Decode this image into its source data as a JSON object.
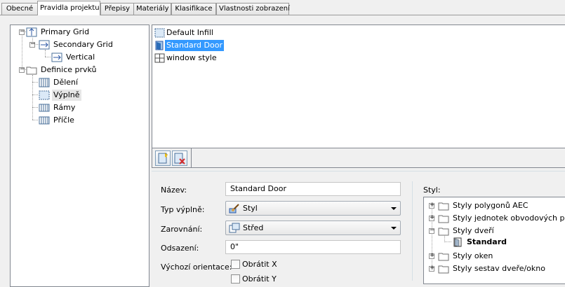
{
  "tabs": [
    {
      "label": "Obecné"
    },
    {
      "label": "Pravidla projektu"
    },
    {
      "label": "Přepisy"
    },
    {
      "label": "Materiály"
    },
    {
      "label": "Klasifikace"
    },
    {
      "label": "Vlastnosti zobrazení"
    }
  ],
  "active_tab": "Pravidla projektu",
  "left_tree": {
    "primary_grid": "Primary Grid",
    "secondary_grid": "Secondary Grid",
    "vertical": "Vertical",
    "definice": "Definice prvků",
    "deleni": "Dělení",
    "vyplne": "Výplně",
    "ramy": "Rámy",
    "pricle": "Příčle"
  },
  "infill_list": {
    "items": [
      {
        "label": "Default Infill",
        "icon": "infill-icon"
      },
      {
        "label": "Standard Door",
        "icon": "door-icon",
        "selected": true
      },
      {
        "label": "window style",
        "icon": "window-icon"
      }
    ]
  },
  "toolbar": {
    "add_icon": "new-infill-icon",
    "remove_icon": "delete-infill-icon"
  },
  "form": {
    "name_label": "Název:",
    "name_value": "Standard Door",
    "type_label": "Typ výplně:",
    "type_value": "Styl",
    "align_label": "Zarovnání:",
    "align_value": "Střed",
    "offset_label": "Odsazení:",
    "offset_value": "0\"",
    "orientation_label": "Výchozí orientace:",
    "flip_x": "Obrátit X",
    "flip_y": "Obrátit Y"
  },
  "style_panel": {
    "label": "Styl:",
    "items": [
      {
        "label": "Styly polygonů AEC"
      },
      {
        "label": "Styly jednotek obvodových plá"
      },
      {
        "label": "Styly dveří"
      },
      {
        "label": "Standard"
      },
      {
        "label": "Styly oken"
      },
      {
        "label": "Styly sestav dveře/okno"
      }
    ]
  },
  "colors": {
    "selection": "#3399ff",
    "panel_border": "#828790"
  }
}
